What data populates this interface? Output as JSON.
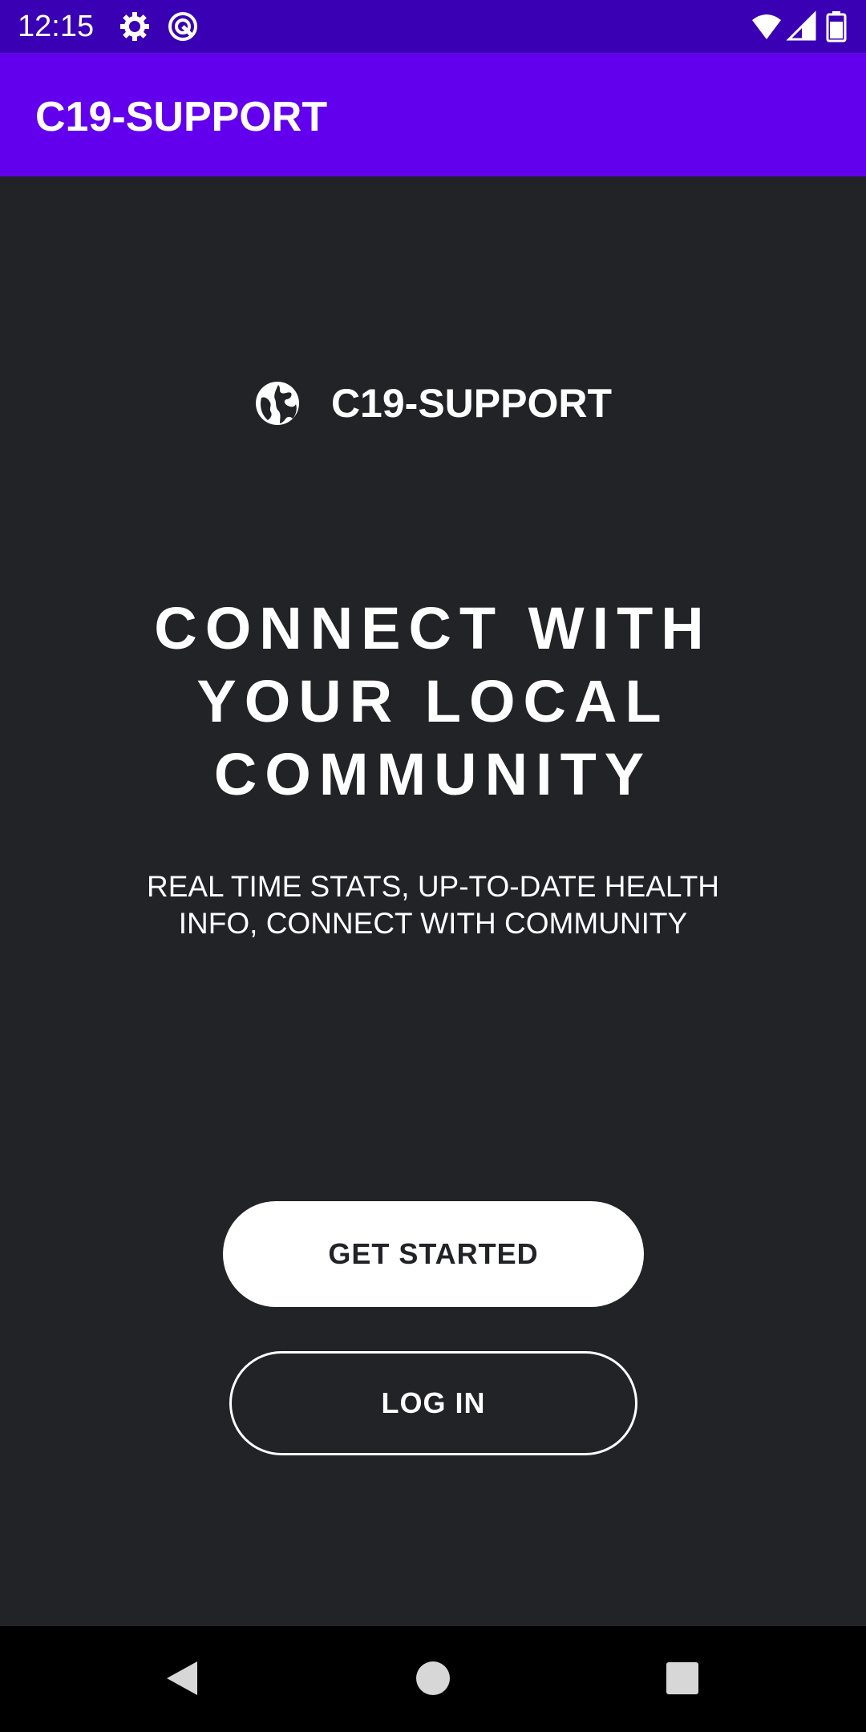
{
  "status_bar": {
    "time": "12:15",
    "icons": [
      "settings-gear-icon",
      "sync-icon",
      "wifi-icon",
      "cell-signal-icon",
      "battery-icon"
    ],
    "background": "#3a00b3"
  },
  "app_bar": {
    "title": "C19-SUPPORT",
    "background": "#6200ee"
  },
  "brand": {
    "icon": "globe-icon",
    "name": "C19-SUPPORT"
  },
  "hero": {
    "headline_lines": [
      "CONNECT WITH",
      "YOUR LOCAL",
      "COMMUNITY"
    ],
    "subtitle_lines": [
      "REAL TIME STATS, UP-TO-DATE HEALTH",
      "INFO, CONNECT WITH COMMUNITY"
    ]
  },
  "actions": {
    "primary_label": "GET STARTED",
    "secondary_label": "LOG IN"
  },
  "nav": {
    "icons": [
      "back-icon",
      "home-icon",
      "recents-icon"
    ]
  },
  "colors": {
    "background": "#222327",
    "primary": "#6200ee",
    "status": "#3a00b3",
    "text": "#ffffff"
  }
}
